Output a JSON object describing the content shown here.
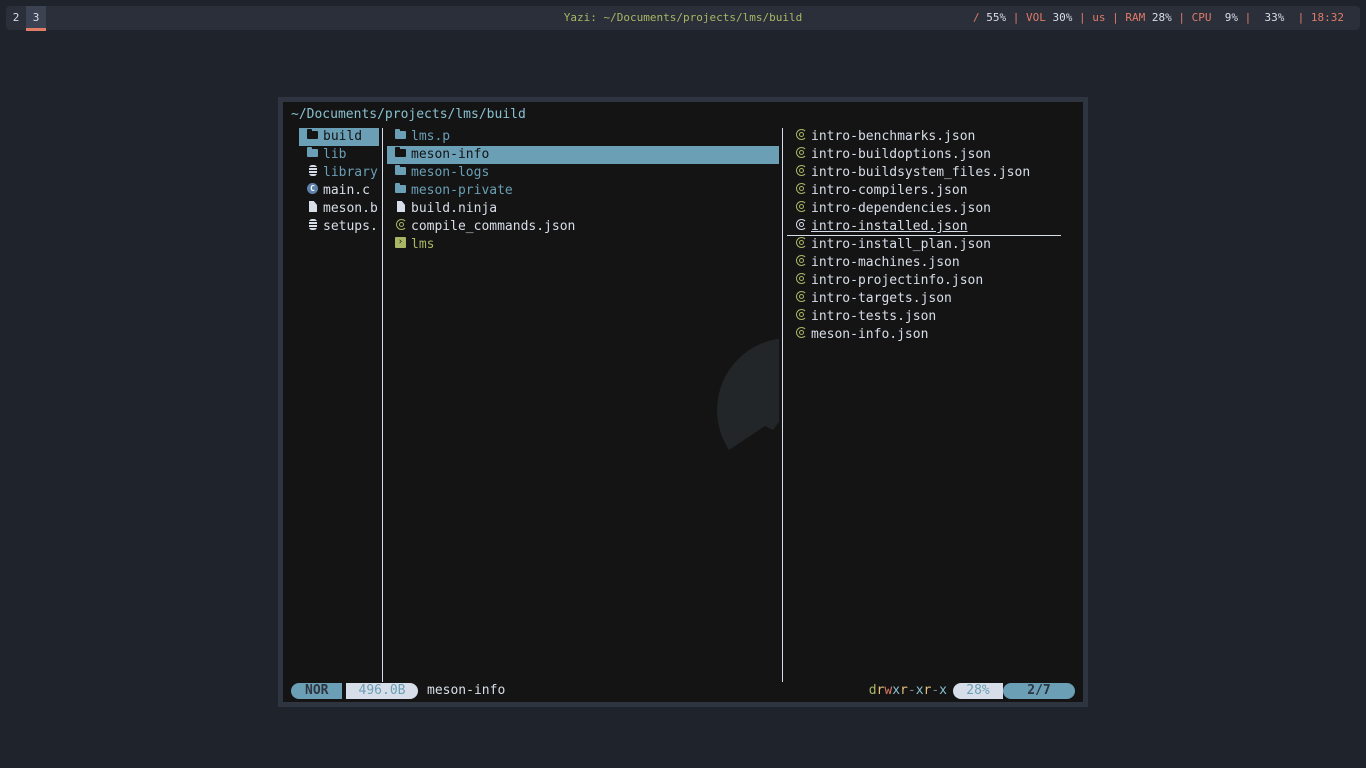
{
  "topbar": {
    "workspaces": [
      "2",
      "3"
    ],
    "active_workspace": "3",
    "title": "Yazi: ~/Documents/projects/lms/build",
    "status": {
      "disk_label": "/",
      "disk_value": "55%",
      "vol_label": "VOL",
      "vol_value": "30%",
      "layout": "us",
      "ram_label": "RAM",
      "ram_value": "28%",
      "cpu_label": "CPU",
      "cpu_value": "9%",
      "battery_value": "33%",
      "clock": "18:32"
    }
  },
  "yazi": {
    "cwd": "~/Documents/projects/lms/build",
    "parent": [
      {
        "name": "build",
        "icon": "folder-icon",
        "type": "dir",
        "selected": true
      },
      {
        "name": "lib",
        "icon": "folder-icon",
        "type": "dir"
      },
      {
        "name": "library",
        "icon": "database-icon",
        "type": "dir"
      },
      {
        "name": "main.c",
        "icon": "c-file-icon",
        "type": "file"
      },
      {
        "name": "meson.b",
        "icon": "file-icon",
        "type": "file"
      },
      {
        "name": "setups.",
        "icon": "database-icon",
        "type": "file"
      }
    ],
    "current": [
      {
        "name": "lms.p",
        "icon": "folder-icon",
        "type": "dir"
      },
      {
        "name": "meson-info",
        "icon": "folder-icon",
        "type": "dir",
        "selected": true
      },
      {
        "name": "meson-logs",
        "icon": "folder-icon",
        "type": "dir"
      },
      {
        "name": "meson-private",
        "icon": "folder-icon",
        "type": "dir"
      },
      {
        "name": "build.ninja",
        "icon": "file-icon",
        "type": "file"
      },
      {
        "name": "compile_commands.json",
        "icon": "json-icon",
        "type": "file"
      },
      {
        "name": "lms",
        "icon": "terminal-icon",
        "type": "exec"
      }
    ],
    "preview": [
      {
        "name": "intro-benchmarks.json",
        "icon": "json-icon"
      },
      {
        "name": "intro-buildoptions.json",
        "icon": "json-icon"
      },
      {
        "name": "intro-buildsystem_files.json",
        "icon": "json-icon"
      },
      {
        "name": "intro-compilers.json",
        "icon": "json-icon"
      },
      {
        "name": "intro-dependencies.json",
        "icon": "json-icon"
      },
      {
        "name": "intro-installed.json",
        "icon": "json-icon",
        "underlined": true
      },
      {
        "name": "intro-install_plan.json",
        "icon": "json-icon"
      },
      {
        "name": "intro-machines.json",
        "icon": "json-icon"
      },
      {
        "name": "intro-projectinfo.json",
        "icon": "json-icon"
      },
      {
        "name": "intro-targets.json",
        "icon": "json-icon"
      },
      {
        "name": "intro-tests.json",
        "icon": "json-icon"
      },
      {
        "name": "meson-info.json",
        "icon": "json-icon"
      }
    ],
    "statusline": {
      "mode": "NOR",
      "size": "496.0B",
      "hovered": "meson-info",
      "permissions": "drwxr-xr-x",
      "percent": "28%",
      "position": "2/7"
    }
  },
  "colors": {
    "background": "#1f232c",
    "terminal": "#141414",
    "accent": "#6a9fb5",
    "warning": "#e07b68",
    "green": "#a9b665"
  }
}
